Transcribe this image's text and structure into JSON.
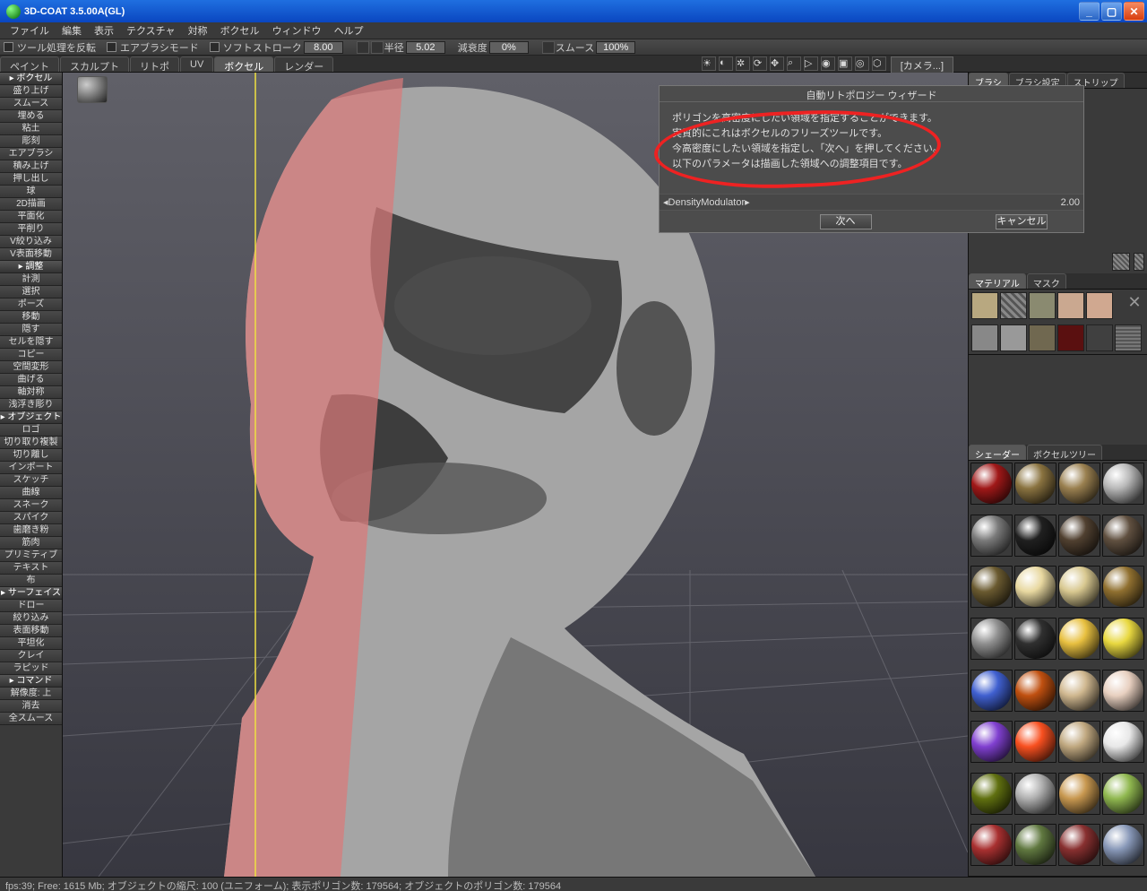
{
  "title": "3D-COAT 3.5.00A(GL)",
  "menu": [
    "ファイル",
    "編集",
    "表示",
    "テクスチャ",
    "対称",
    "ボクセル",
    "ウィンドウ",
    "ヘルプ"
  ],
  "params": {
    "tool_invert": "ツール処理を反転",
    "airbrush": "エアブラシモード",
    "softstroke": "ソフトストローク",
    "softstroke_val": "8.00",
    "radius_label": "半径",
    "radius_val": "5.02",
    "depth_label": "減衰度",
    "depth_val": "0%",
    "smooth_label": "スムース",
    "smooth_val": "100%"
  },
  "main_tabs": [
    "ペイント",
    "スカルプト",
    "リトポ",
    "UV",
    "ボクセル",
    "レンダー"
  ],
  "main_tab_active": 4,
  "camera_btn": "[カメラ...]",
  "left_tools": [
    {
      "t": "▸ ボクセル",
      "h": 1
    },
    {
      "t": "盛り上げ"
    },
    {
      "t": "スムース"
    },
    {
      "t": "埋める"
    },
    {
      "t": "粘土"
    },
    {
      "t": "彫刻"
    },
    {
      "t": "エアブラシ"
    },
    {
      "t": "積み上げ"
    },
    {
      "t": "押し出し"
    },
    {
      "t": "球"
    },
    {
      "t": "2D描画"
    },
    {
      "t": "平面化"
    },
    {
      "t": "平削り"
    },
    {
      "t": "V絞り込み"
    },
    {
      "t": "V表面移動"
    },
    {
      "t": "▸ 調整",
      "h": 1
    },
    {
      "t": "計測"
    },
    {
      "t": "選択"
    },
    {
      "t": "ポーズ"
    },
    {
      "t": "移動"
    },
    {
      "t": "隠す"
    },
    {
      "t": "セルを隠す"
    },
    {
      "t": "コピー"
    },
    {
      "t": "空間変形"
    },
    {
      "t": "曲げる"
    },
    {
      "t": "軸対称"
    },
    {
      "t": "浅浮き彫り"
    },
    {
      "t": "▸ オブジェクト",
      "h": 1
    },
    {
      "t": "ロゴ"
    },
    {
      "t": "切り取り複製"
    },
    {
      "t": "切り離し"
    },
    {
      "t": "インポート"
    },
    {
      "t": "スケッチ"
    },
    {
      "t": "曲線"
    },
    {
      "t": "スネーク"
    },
    {
      "t": "スパイク"
    },
    {
      "t": "歯磨き粉"
    },
    {
      "t": "筋肉"
    },
    {
      "t": "プリミティブ"
    },
    {
      "t": "テキスト"
    },
    {
      "t": "布"
    },
    {
      "t": "▸ サーフェイス",
      "h": 1
    },
    {
      "t": "ドロー"
    },
    {
      "t": "絞り込み"
    },
    {
      "t": "表面移動"
    },
    {
      "t": "平坦化"
    },
    {
      "t": "クレイ"
    },
    {
      "t": "ラピッド"
    },
    {
      "t": "▸ コマンド",
      "h": 1
    },
    {
      "t": "解像度: 上"
    },
    {
      "t": "消去"
    },
    {
      "t": "全スムース"
    }
  ],
  "right_panels": {
    "brush_tabs": [
      "ブラシ",
      "ブラシ設定",
      "ストリップ"
    ],
    "material_tabs": [
      "マテリアル",
      "マスク"
    ],
    "shader_tabs": [
      "シェーダー",
      "ボクセルツリー"
    ]
  },
  "wizard": {
    "title": "自動リトポロジー ウィザード",
    "lines": [
      "ポリゴンを高密度にしたい領域を指定することができます。",
      "実質的にこれはボクセルのフリーズツールです。",
      "今高密度にしたい領域を指定し、「次へ」を押してください。",
      "以下のパラメータは描画した領域への調整項目です。"
    ],
    "param_label": "◂DensityModulator▸",
    "param_val": "2.00",
    "next": "次へ",
    "cancel": "キャンセル"
  },
  "shaders": [
    "#a01818",
    "#8a7340",
    "#9a8050",
    "#b8b8b8",
    "#7a7a7a",
    "#202020",
    "#504030",
    "#605040",
    "#6a5a30",
    "#e8d8a0",
    "#d8c890",
    "#907030",
    "#909090",
    "#303030",
    "#e8c040",
    "#e8d840",
    "#4060d0",
    "#c05010",
    "#d0b890",
    "#e8d0c0",
    "#8040d0",
    "#f85020",
    "#c0a880",
    "#e8e8e8",
    "#607010",
    "#b0b0b0",
    "#c89850",
    "#90b850",
    "#a83030",
    "#607840",
    "#883030",
    "#8898b8"
  ],
  "status": "fps:39;    Free: 1615 Mb; オブジェクトの縮尺: 100 (ユニフォーム); 表示ポリゴン数: 179564; オブジェクトのポリゴン数: 179564"
}
